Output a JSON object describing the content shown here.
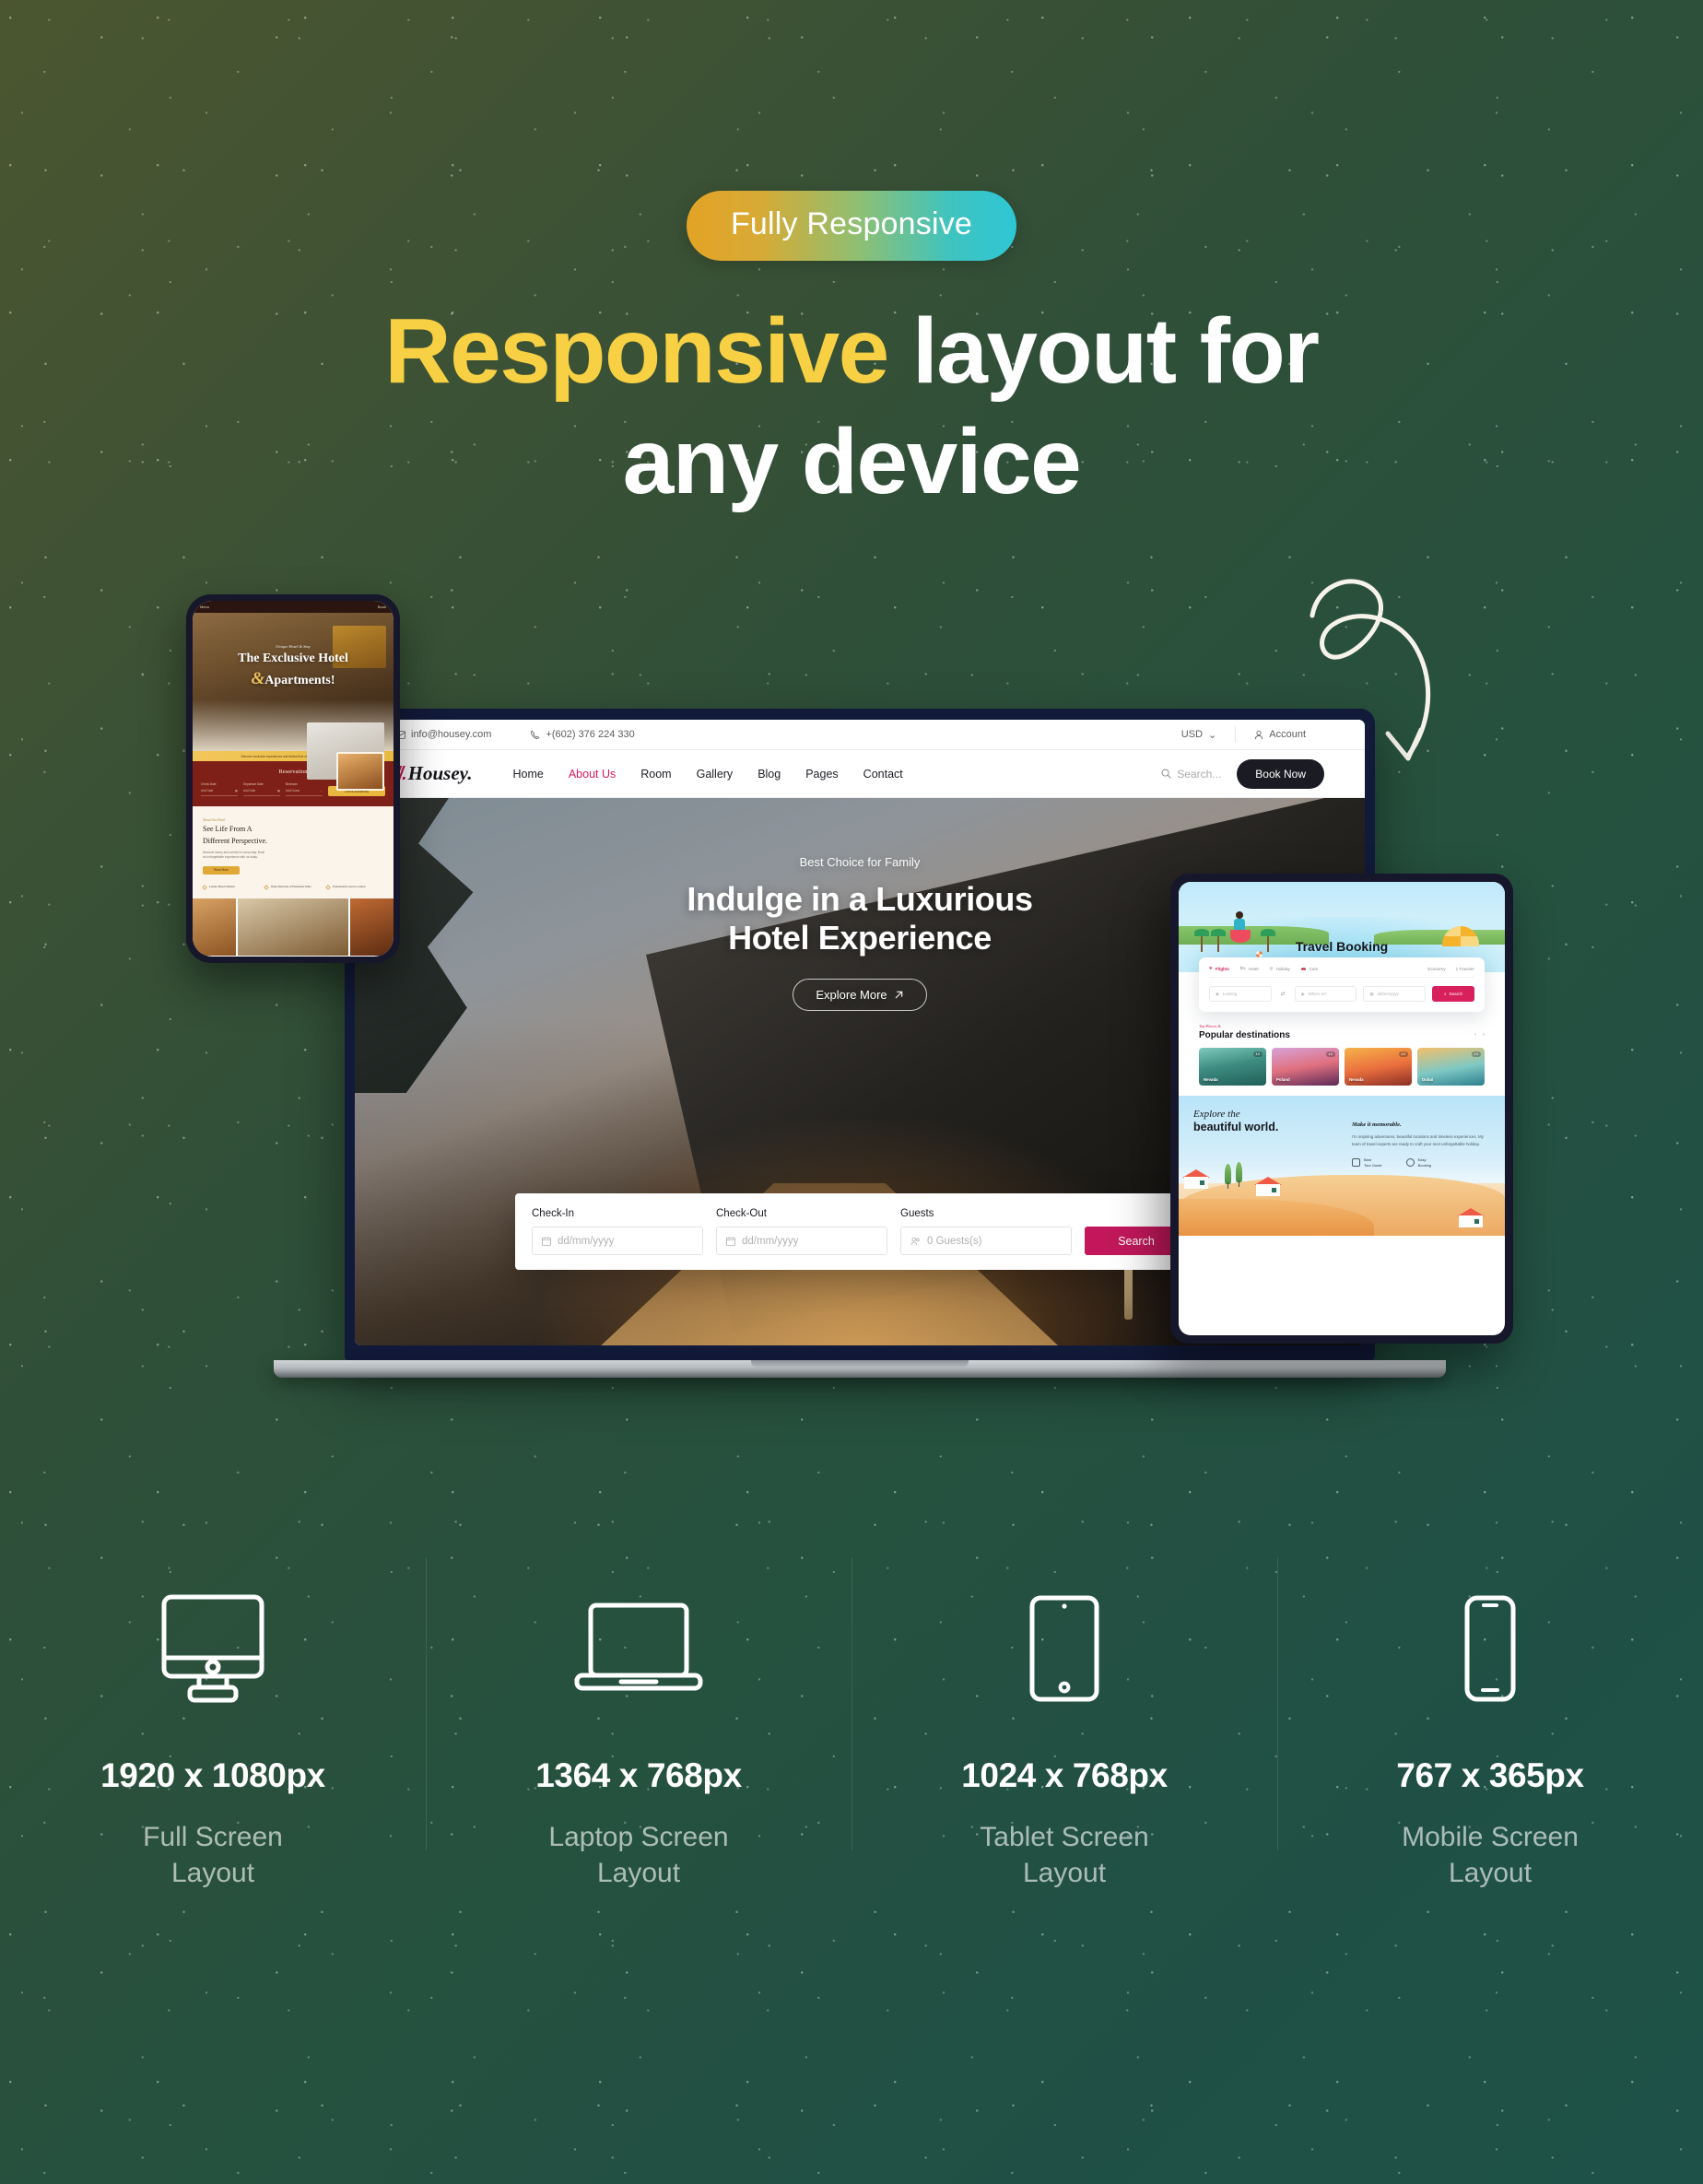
{
  "badge": {
    "label": "Fully Responsive"
  },
  "headline": {
    "accent": "Responsive",
    "rest": " layout for",
    "line2": "any device"
  },
  "laptop": {
    "topbar": {
      "email": "info@housey.com",
      "phone": "+(602) 376 224 330",
      "currency": "USD",
      "account": "Account"
    },
    "brand": {
      "mark": "//.",
      "name": "Housey."
    },
    "nav": [
      "Home",
      "About Us",
      "Room",
      "Gallery",
      "Blog",
      "Pages",
      "Contact"
    ],
    "active_nav": "About Us",
    "search_placeholder": "Search...",
    "book_now": "Book Now",
    "hero": {
      "eyebrow": "Best Choice for Family",
      "title_line1": "Indulge in a Luxurious",
      "title_line2": "Hotel Experience",
      "cta": "Explore More",
      "cta_icon": "arrow-up-right-icon"
    },
    "bookform": {
      "checkin_label": "Check-In",
      "checkin_placeholder": "dd/mm/yyyy",
      "checkout_label": "Check-Out",
      "checkout_placeholder": "dd/mm/yyyy",
      "guests_label": "Guests",
      "guests_placeholder": "0 Guests(s)",
      "search_button": "Search"
    }
  },
  "phone": {
    "nav_left": "Menu",
    "nav_right": "Book",
    "hero": {
      "eyebrow": "Unique Hotel & Stay",
      "title_line1": "The Exclusive Hotel",
      "amp": "&",
      "title_line2": "Apartments!"
    },
    "strip": "Discover exclusive experiences and limited-time offers for your next stay with us",
    "reservation": {
      "title": "Reservation",
      "checkin_label": "Check Date",
      "checkin_value": "Add Date",
      "checkout_label": "Departure Date",
      "checkout_value": "Add Date",
      "guests_label": "Bedroom",
      "guests_value": "Add Guest",
      "button": "Check Availability"
    },
    "about": {
      "eyebrow": "About Our Hotel",
      "title_line1": "See Life From A",
      "title_line2": "Different Perspective.",
      "paragraph": "Discover luxury and comfort in every stay. Book an unforgettable experience with us today.",
      "button": "Read More",
      "features": [
        "Luxury Hotel Oriental",
        "Daily Diversity of Elemental Value",
        "Promotional Latest Location"
      ]
    }
  },
  "tablet": {
    "title": "Travel Booking",
    "tabs": [
      "Flights",
      "Hotel",
      "Holiday",
      "Cars"
    ],
    "active_tab": "Flights",
    "tabs_right": [
      "Economy",
      "1 Traveler"
    ],
    "search_row": {
      "from_placeholder": "Leaving",
      "swap_icon": "swap-icon",
      "to_placeholder": "Where to?",
      "date_placeholder": "dd/mm/yyyy",
      "button": "Search"
    },
    "popular": {
      "eyebrow": "Top Places &",
      "title": "Popular destinations",
      "cards": [
        {
          "name": "Nevada",
          "rating": "4.6"
        },
        {
          "name": "Poland",
          "rating": "4.8"
        },
        {
          "name": "Nevada",
          "rating": "4.5"
        },
        {
          "name": "Dubai",
          "rating": "4.9"
        }
      ]
    },
    "explore": {
      "title_line1": "Explore the",
      "title_line2": "beautiful world.",
      "subtitle": "Make it memorable.",
      "paragraph": "I'm inspiring adventures, beautiful locations and timeless experiences. My team of travel experts are ready to craft your next unforgettable holiday.",
      "features": [
        {
          "line1": "Best",
          "line2": "Tour Guide"
        },
        {
          "line1": "Easy",
          "line2": "Booking"
        }
      ]
    }
  },
  "specs": [
    {
      "icon": "monitor-icon",
      "size": "1920 x 1080px",
      "name_line1": "Full Screen",
      "name_line2": "Layout"
    },
    {
      "icon": "laptop-icon",
      "size": "1364 x 768px",
      "name_line1": "Laptop Screen",
      "name_line2": "Layout"
    },
    {
      "icon": "tablet-icon",
      "size": "1024 x 768px",
      "name_line1": "Tablet Screen",
      "name_line2": "Layout"
    },
    {
      "icon": "mobile-icon",
      "size": "767 x 365px",
      "name_line1": "Mobile Screen",
      "name_line2": "Layout"
    }
  ],
  "colors": {
    "bg_start": "#4b5630",
    "bg_end": "#1e5248",
    "headline_accent": "#f7d044",
    "badge_start": "#e3a325",
    "badge_end": "#2ec6d6",
    "hotel_accent": "#c2185b",
    "travel_accent": "#d8205c",
    "phone_accent": "#e9b93f"
  }
}
